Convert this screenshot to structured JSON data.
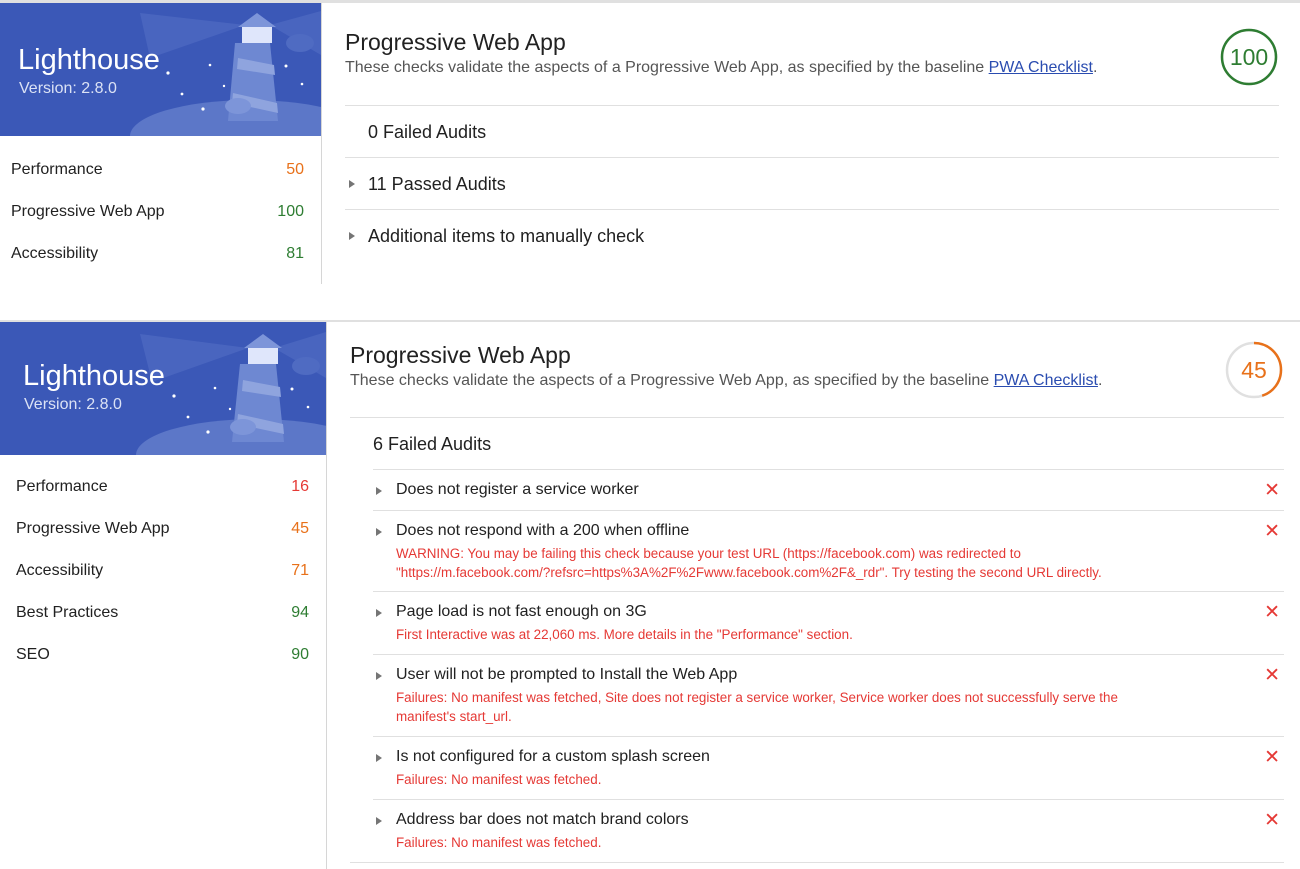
{
  "colors": {
    "pass": "#2e7d32",
    "average": "#e8711a",
    "fail": "#e53935",
    "brand": "#3b58b7"
  },
  "panel1": {
    "header": {
      "title": "Lighthouse",
      "version": "Version: 2.8.0"
    },
    "categories": [
      {
        "label": "Performance",
        "score": "50"
      },
      {
        "label": "Progressive Web App",
        "score": "100"
      },
      {
        "label": "Accessibility",
        "score": "81"
      }
    ],
    "section": {
      "title": "Progressive Web App",
      "desc_prefix": "These checks validate the aspects of a Progressive Web App, as specified by the baseline ",
      "link": "PWA Checklist",
      "desc_suffix": ".",
      "score": "100",
      "score_fraction": 1.0
    },
    "groups": {
      "failed": "0 Failed Audits",
      "passed": "11 Passed Audits",
      "manual": "Additional items to manually check"
    }
  },
  "panel2": {
    "header": {
      "title": "Lighthouse",
      "version": "Version: 2.8.0"
    },
    "categories": [
      {
        "label": "Performance",
        "score": "16"
      },
      {
        "label": "Progressive Web App",
        "score": "45"
      },
      {
        "label": "Accessibility",
        "score": "71"
      },
      {
        "label": "Best Practices",
        "score": "94"
      },
      {
        "label": "SEO",
        "score": "90"
      }
    ],
    "section": {
      "title": "Progressive Web App",
      "desc_prefix": "These checks validate the aspects of a Progressive Web App, as specified by the baseline ",
      "link": "PWA Checklist",
      "desc_suffix": ".",
      "score": "45",
      "score_fraction": 0.45
    },
    "groups": {
      "failed": "6 Failed Audits"
    },
    "audits": [
      {
        "title": "Does not register a service worker",
        "detail": ""
      },
      {
        "title": "Does not respond with a 200 when offline",
        "detail": "WARNING: You may be failing this check because your test URL (https://facebook.com) was redirected to \"https://m.facebook.com/?refsrc=https%3A%2F%2Fwww.facebook.com%2F&_rdr\". Try testing the second URL directly."
      },
      {
        "title": "Page load is not fast enough on 3G",
        "detail": "First Interactive was at 22,060 ms. More details in the \"Performance\" section."
      },
      {
        "title": "User will not be prompted to Install the Web App",
        "detail": "Failures: No manifest was fetched, Site does not register a service worker, Service worker does not successfully serve the manifest's start_url."
      },
      {
        "title": "Is not configured for a custom splash screen",
        "detail": "Failures: No manifest was fetched."
      },
      {
        "title": "Address bar does not match brand colors",
        "detail": "Failures: No manifest was fetched."
      }
    ],
    "fail_mark": "✕"
  }
}
